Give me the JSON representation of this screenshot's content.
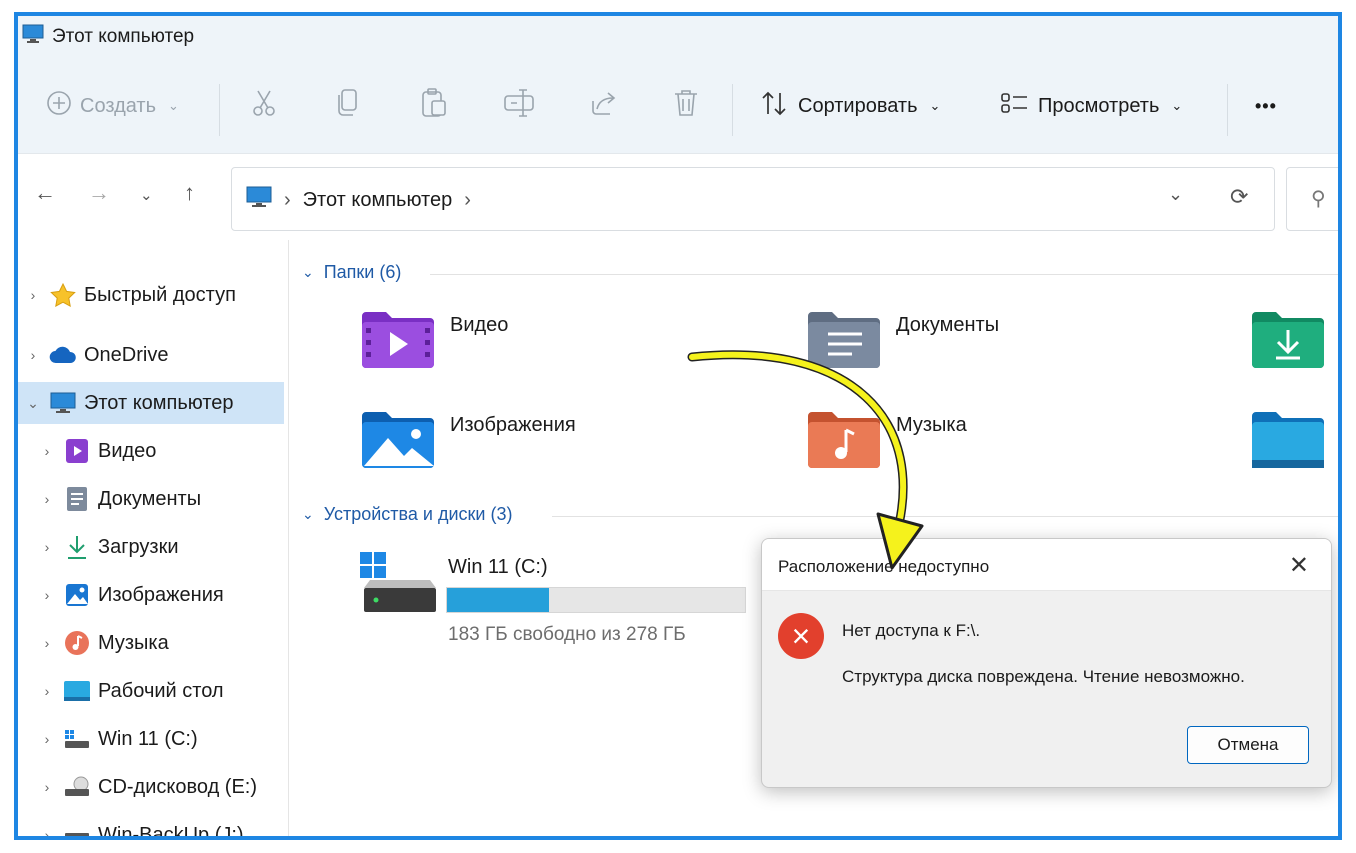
{
  "window": {
    "title": "Этот компьютер"
  },
  "toolbar": {
    "create_label": "Создать",
    "sort_label": "Сортировать",
    "view_label": "Просмотреть",
    "more_label": "•••"
  },
  "address": {
    "path_label": "Этот компьютер"
  },
  "sidebar": {
    "items": [
      {
        "label": "Быстрый доступ"
      },
      {
        "label": "OneDrive"
      },
      {
        "label": "Этот компьютер"
      },
      {
        "label": "Видео"
      },
      {
        "label": "Документы"
      },
      {
        "label": "Загрузки"
      },
      {
        "label": "Изображения"
      },
      {
        "label": "Музыка"
      },
      {
        "label": "Рабочий стол"
      },
      {
        "label": "Win 11 (C:)"
      },
      {
        "label": "CD-дисковод (E:)"
      },
      {
        "label": "Win-BackUp (J:)"
      }
    ]
  },
  "content": {
    "folders_header": "Папки (6)",
    "folders": [
      {
        "label": "Видео"
      },
      {
        "label": "Документы"
      },
      {
        "label": "Изображения"
      },
      {
        "label": "Музыка"
      }
    ],
    "devices_header": "Устройства и диски (3)",
    "drive": {
      "name": "Win 11 (C:)",
      "free_text": "183 ГБ свободно из 278 ГБ",
      "used_fraction": 0.342
    }
  },
  "dialog": {
    "title": "Расположение недоступно",
    "message1": "Нет доступа к F:\\.",
    "message2": "Структура диска повреждена. Чтение невозможно.",
    "cancel_label": "Отмена"
  },
  "colors": {
    "accent": "#1e86e3",
    "selection": "#cfe4f7",
    "error": "#e2402d",
    "drive_fill": "#26a0da",
    "arrow": "#f5f21c"
  }
}
